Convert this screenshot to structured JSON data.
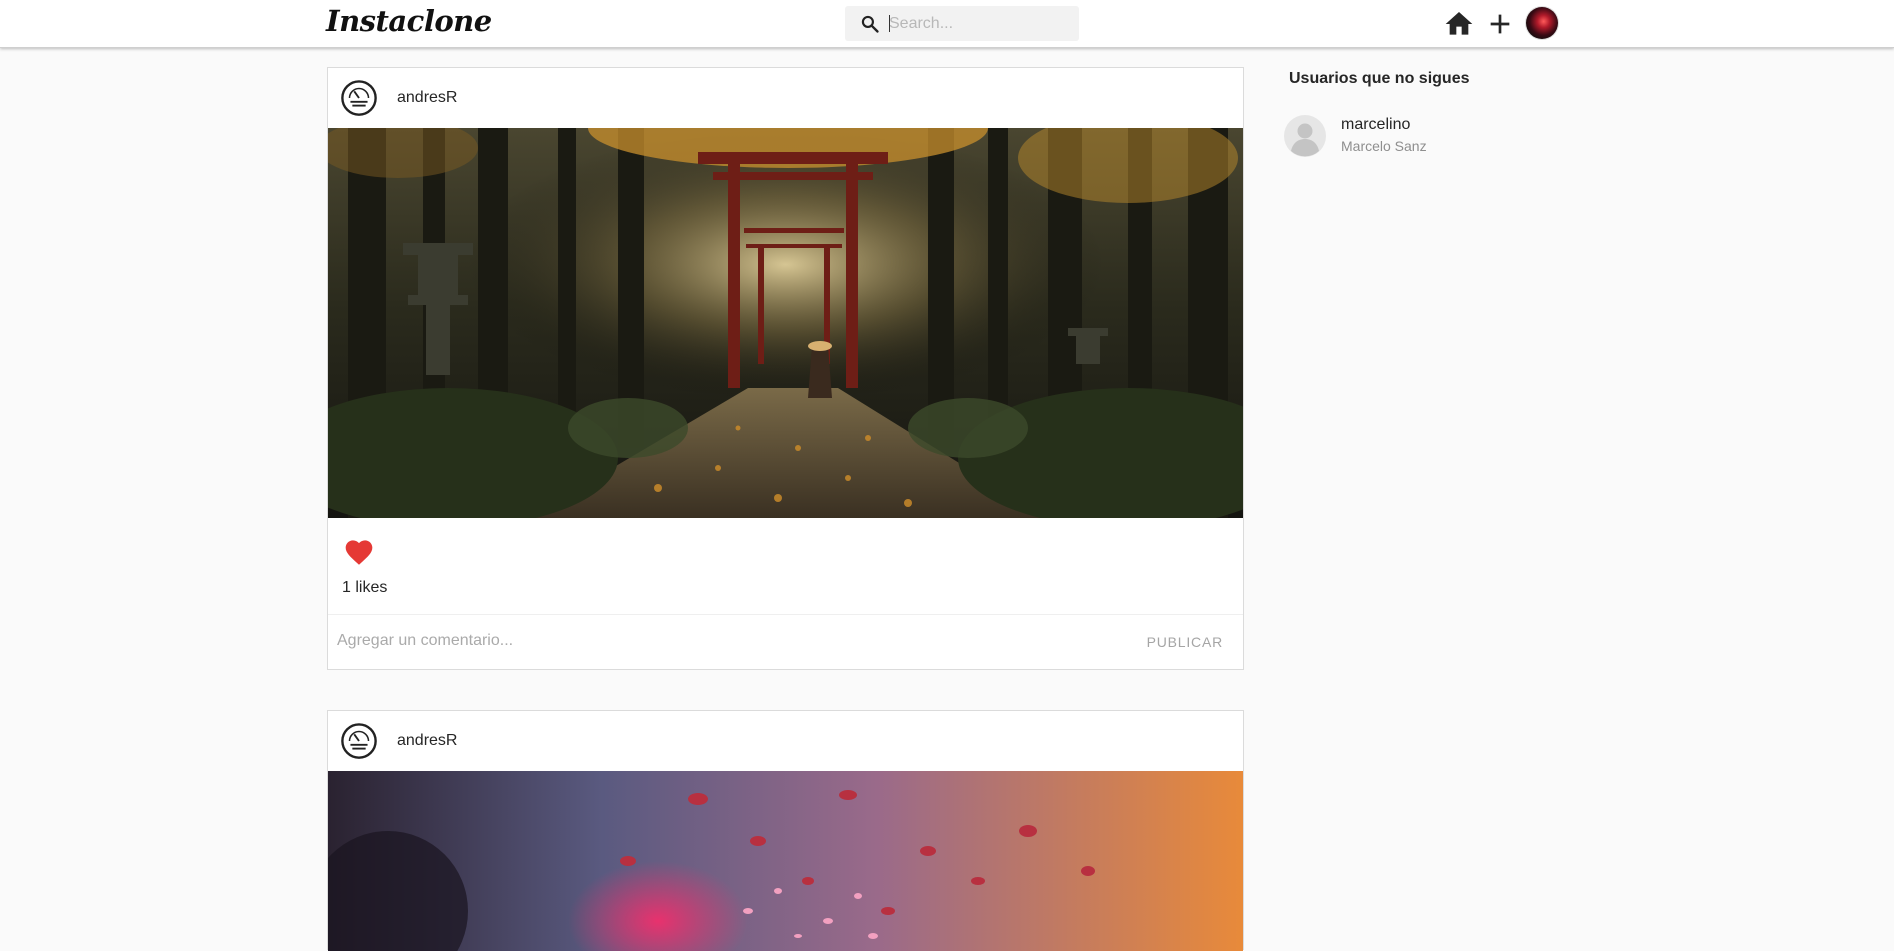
{
  "header": {
    "logo": "Instaclone",
    "search_placeholder": "Search...",
    "icons": [
      "home-icon",
      "plus-icon",
      "profile-avatar"
    ]
  },
  "posts": [
    {
      "username": "andresR",
      "image": "forest-torii-gate-photo",
      "liked": true,
      "likes_text": "1 likes",
      "comment_placeholder": "Agregar un comentario...",
      "publish_label": "PUBLICAR"
    },
    {
      "username": "andresR",
      "image": "blurred-petals-photo"
    }
  ],
  "sidebar": {
    "title": "Usuarios que no sigues",
    "suggestions": [
      {
        "username": "marcelino",
        "full_name": "Marcelo Sanz"
      }
    ]
  },
  "colors": {
    "like_red": "#e53935",
    "border": "#dbdbdb",
    "background": "#fafafa"
  }
}
